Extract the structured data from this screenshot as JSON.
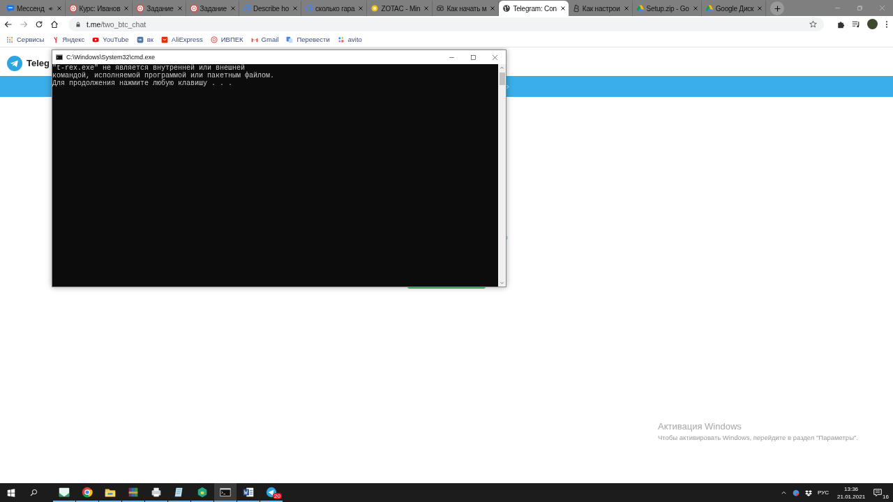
{
  "browser": {
    "tabs": [
      {
        "title": "Мессенд",
        "kind": "chat",
        "audio": true,
        "selected": false
      },
      {
        "title": "Курс: Иванов",
        "kind": "ring",
        "audio": false,
        "selected": false
      },
      {
        "title": "Задание",
        "kind": "ring",
        "audio": false,
        "selected": false
      },
      {
        "title": "Задание",
        "kind": "ring",
        "audio": false,
        "selected": false
      },
      {
        "title": "Describe ho",
        "kind": "google",
        "audio": false,
        "selected": false
      },
      {
        "title": "сколько гара",
        "kind": "google",
        "audio": false,
        "selected": false
      },
      {
        "title": "ZOTAC - Min",
        "kind": "coin",
        "audio": false,
        "selected": false
      },
      {
        "title": "Как начать м",
        "kind": "glasses",
        "audio": false,
        "selected": false
      },
      {
        "title": "Telegram: Con",
        "kind": "globe",
        "audio": false,
        "selected": true
      },
      {
        "title": "Как настрои",
        "kind": "bitcoin",
        "audio": false,
        "selected": false
      },
      {
        "title": "Setup.zip - Go",
        "kind": "drive",
        "audio": false,
        "selected": false
      },
      {
        "title": "Google Диск",
        "kind": "drive",
        "audio": false,
        "selected": false
      }
    ],
    "address": {
      "host": "t.me",
      "path": "/two_btc_chat"
    },
    "bookmarks": [
      {
        "label": "Сервисы",
        "kind": "apps"
      },
      {
        "label": "Яндекс",
        "kind": "yandex"
      },
      {
        "label": "YouTube",
        "kind": "youtube"
      },
      {
        "label": "вк",
        "kind": "vk"
      },
      {
        "label": "AliExpress",
        "kind": "ali"
      },
      {
        "label": "ИВПЕК",
        "kind": "ring"
      },
      {
        "label": "Gmail",
        "kind": "gmail"
      },
      {
        "label": "Перевести",
        "kind": "translate"
      },
      {
        "label": "avito",
        "kind": "dots"
      }
    ]
  },
  "page": {
    "brand": "Teleg"
  },
  "console": {
    "title": "C:\\Windows\\System32\\cmd.exe",
    "lines": [
      "\"t-rex.exe\" не является внутренней или внешней",
      "командой, исполняемой программой или пакетным файлом.",
      "Для продолжения нажмите любую клавишу . . ."
    ]
  },
  "activation": {
    "title": "Активация Windows",
    "text": "Чтобы активировать Windows, перейдите в раздел \"Параметры\"."
  },
  "taskbar": {
    "apps": [
      {
        "kind": "mail",
        "selected": false
      },
      {
        "kind": "chrome",
        "selected": false
      },
      {
        "kind": "folder",
        "selected": false
      },
      {
        "kind": "archive",
        "selected": false
      },
      {
        "kind": "printer",
        "selected": false
      },
      {
        "kind": "notepad",
        "selected": false
      },
      {
        "kind": "shield",
        "selected": false
      },
      {
        "kind": "console",
        "selected": true
      },
      {
        "kind": "word",
        "selected": false
      },
      {
        "kind": "telegram",
        "selected": false,
        "badge": "20"
      }
    ],
    "language": "РУС",
    "time": "13:36",
    "date": "21.01.2021",
    "notifications": "16"
  }
}
